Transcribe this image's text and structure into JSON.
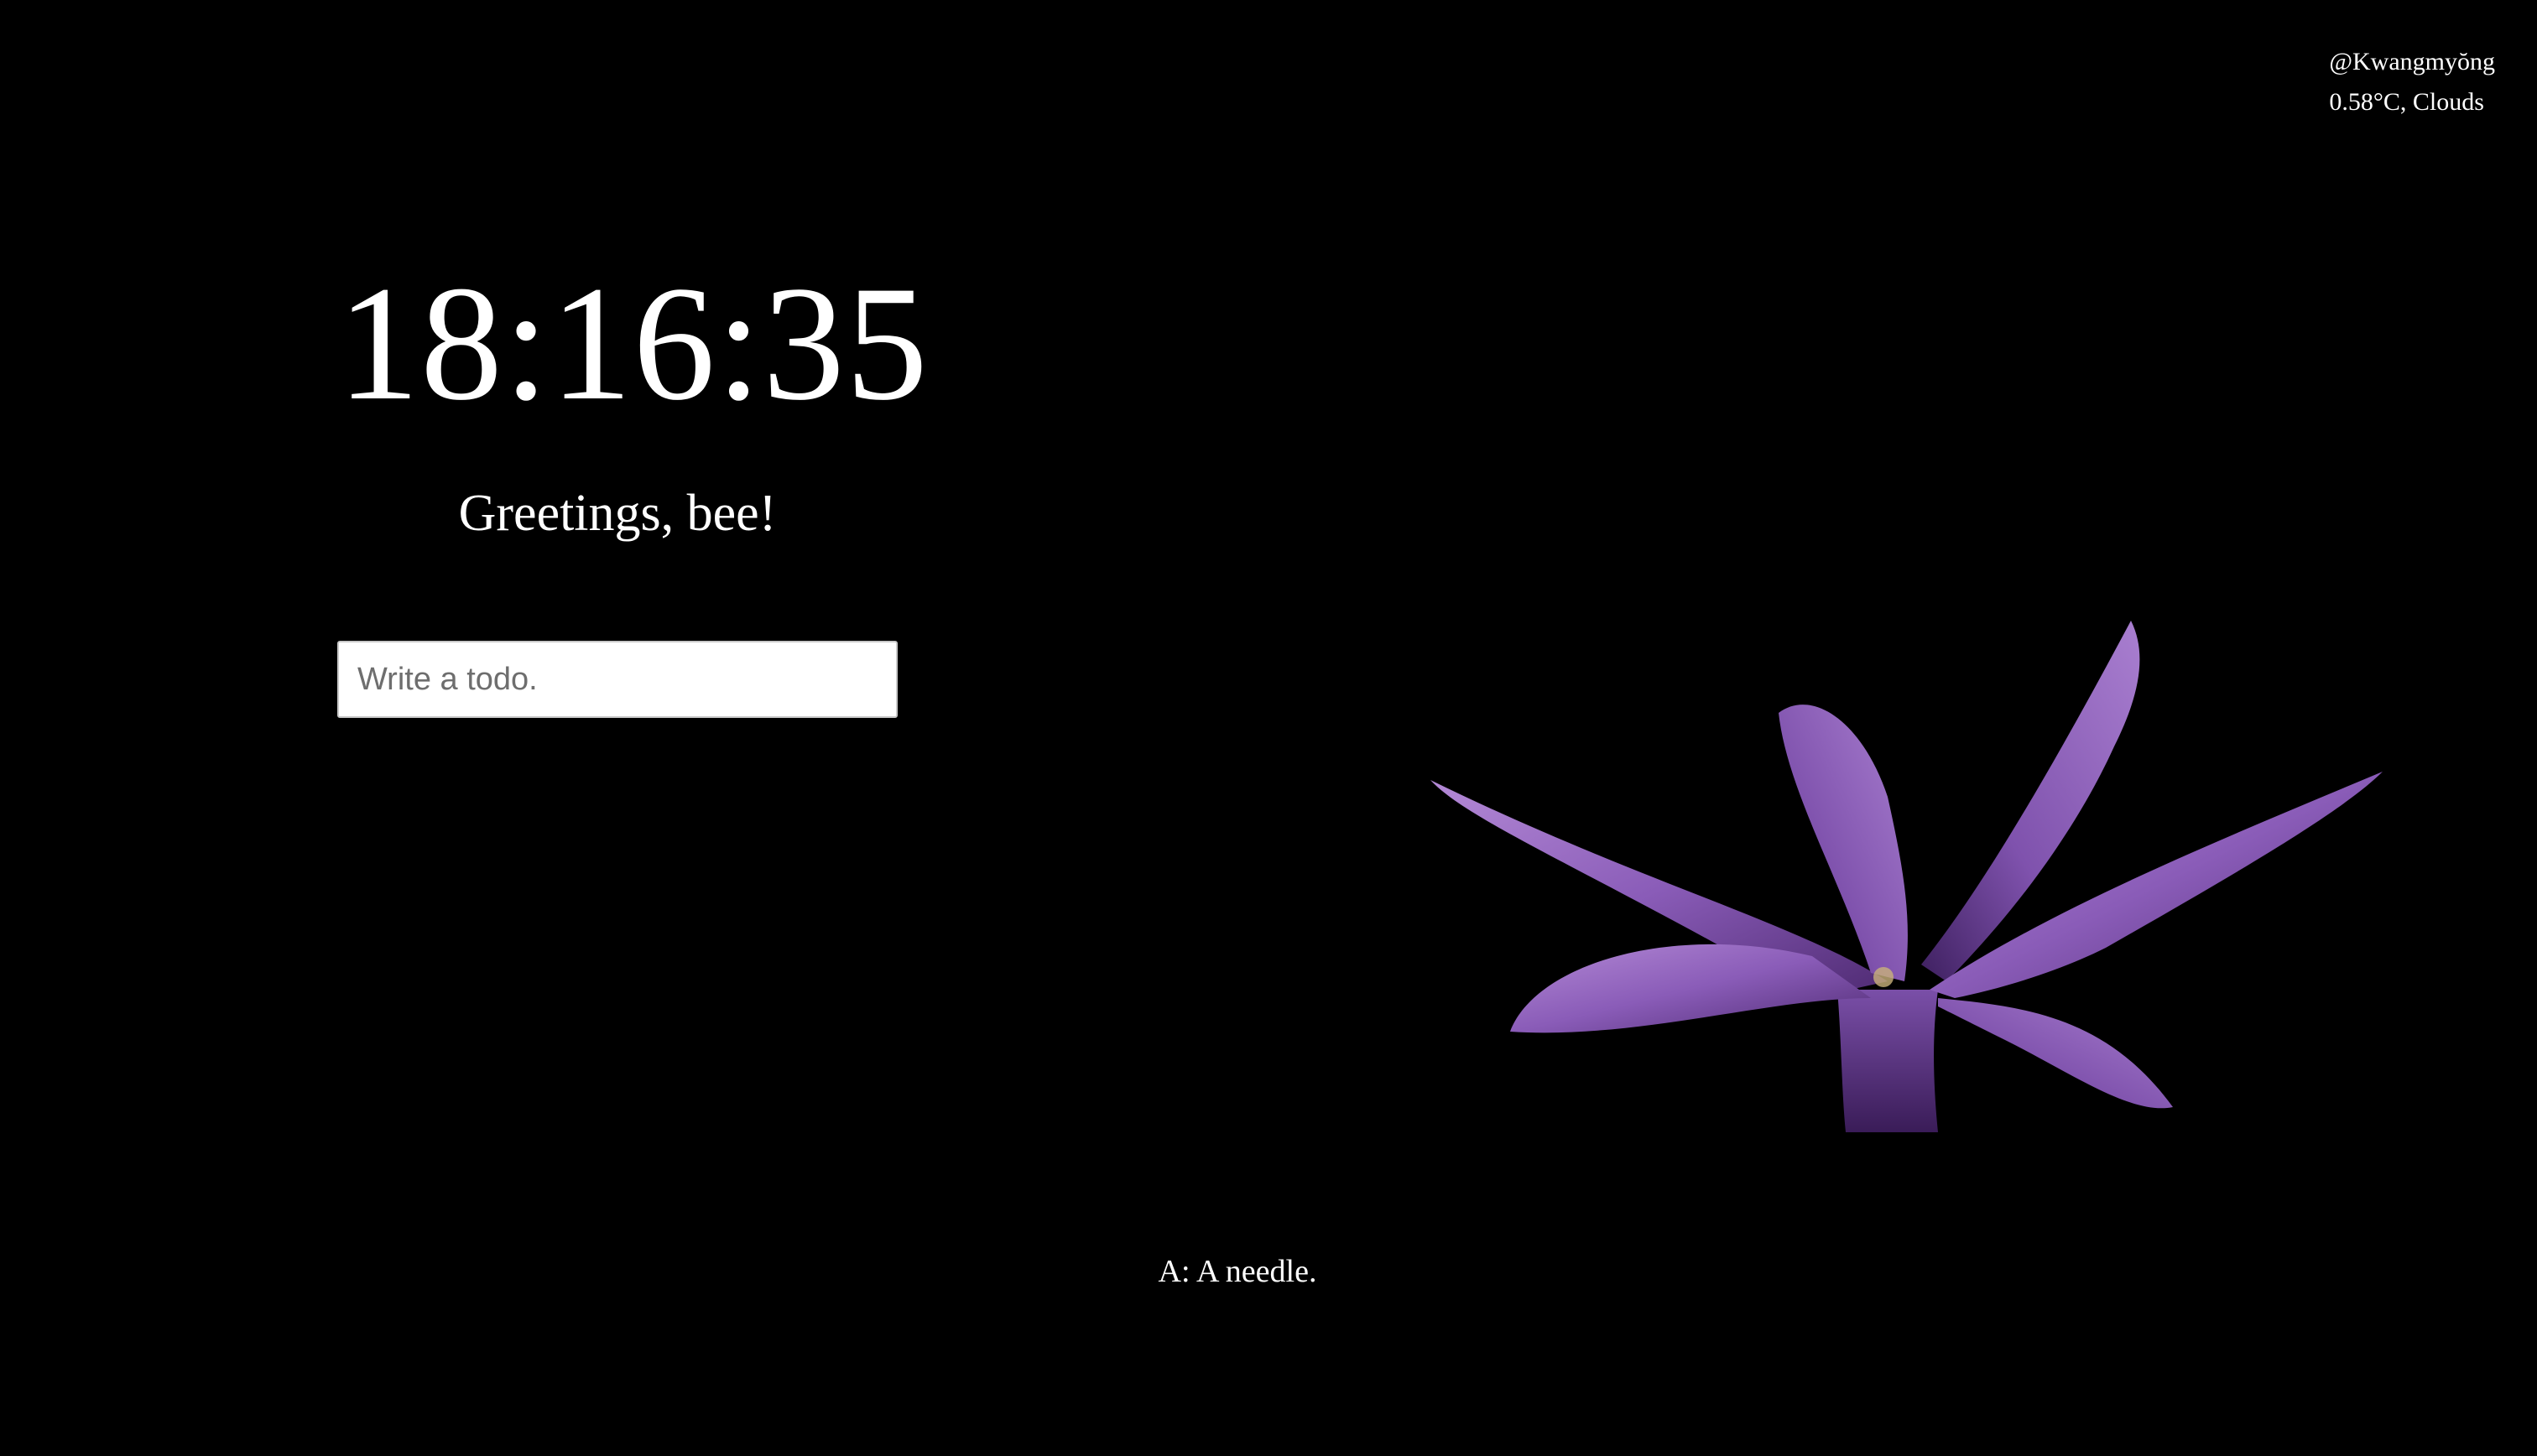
{
  "weather": {
    "location": "@Kwangmyŏng",
    "condition": "0.58°C, Clouds"
  },
  "clock": {
    "time": "18:16:35"
  },
  "greeting": {
    "text": "Greetings, bee!"
  },
  "todo": {
    "placeholder": "Write a todo.",
    "value": ""
  },
  "quote": {
    "text": "A: A needle."
  },
  "background": {
    "subject": "purple-flower-photo",
    "page_color": "#000000",
    "petal_color": "#9a6bc4"
  }
}
